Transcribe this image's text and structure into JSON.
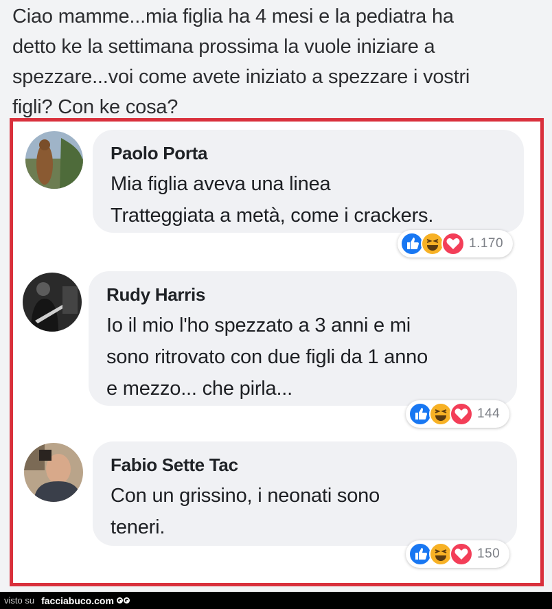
{
  "post": {
    "lines": [
      "Ciao mamme...mia figlia ha 4 mesi e la pediatra ha",
      "detto ke la settimana prossima la vuole iniziare a",
      "spezzare...voi come avete iniziato a spezzare i vostri",
      "figli? Con ke cosa?"
    ]
  },
  "comments": [
    {
      "author": "Paolo Porta",
      "lines": [
        "Mia figlia aveva una linea",
        "Tratteggiata a metà, come i crackers."
      ],
      "reaction_count": "1.170"
    },
    {
      "author": "Rudy Harris",
      "lines": [
        "Io il mio l'ho spezzato a 3 anni e mi",
        "sono ritrovato con due figli da 1 anno",
        "e mezzo... che pirla..."
      ],
      "reaction_count": "144"
    },
    {
      "author": "Fabio Sette Tac",
      "lines": [
        "Con un grissino, i neonati sono",
        "teneri."
      ],
      "reaction_count": "150"
    }
  ],
  "footer": {
    "visto_su": "visto su",
    "site": "facciabuco.com"
  },
  "colors": {
    "frame": "#d9303c",
    "like": "#1877f2",
    "haha": "#f7b125",
    "love": "#f33e58"
  },
  "icons": [
    "like-reaction-icon",
    "haha-reaction-icon",
    "love-reaction-icon",
    "eyes-logo-icon"
  ]
}
